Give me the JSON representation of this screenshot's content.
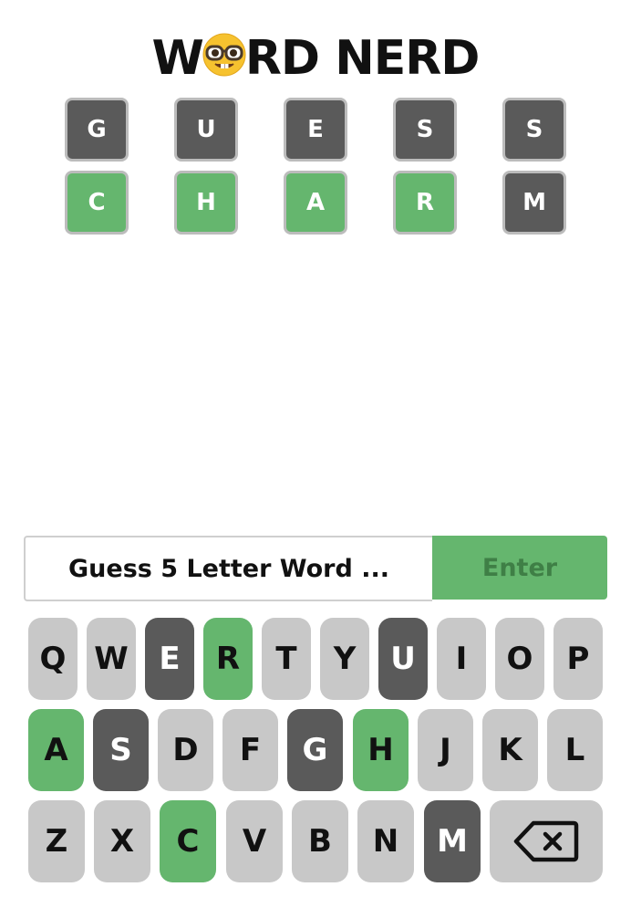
{
  "title": {
    "part1": "W",
    "part2": "RD NERD",
    "emoji": "nerd-face-icon"
  },
  "board": {
    "rows": [
      {
        "tiles": [
          {
            "letter": "G",
            "state": "dark"
          },
          {
            "letter": "U",
            "state": "dark"
          },
          {
            "letter": "E",
            "state": "dark"
          },
          {
            "letter": "S",
            "state": "dark"
          },
          {
            "letter": "S",
            "state": "dark"
          }
        ]
      },
      {
        "tiles": [
          {
            "letter": "C",
            "state": "green"
          },
          {
            "letter": "H",
            "state": "green"
          },
          {
            "letter": "A",
            "state": "green"
          },
          {
            "letter": "R",
            "state": "green"
          },
          {
            "letter": "M",
            "state": "dark"
          }
        ]
      }
    ]
  },
  "input": {
    "placeholder": "Guess 5 Letter Word ...",
    "enter_label": "Enter"
  },
  "keyboard": {
    "row1": [
      {
        "k": "Q",
        "s": "light"
      },
      {
        "k": "W",
        "s": "light"
      },
      {
        "k": "E",
        "s": "dark"
      },
      {
        "k": "R",
        "s": "green"
      },
      {
        "k": "T",
        "s": "light"
      },
      {
        "k": "Y",
        "s": "light"
      },
      {
        "k": "U",
        "s": "dark"
      },
      {
        "k": "I",
        "s": "light"
      },
      {
        "k": "O",
        "s": "light"
      },
      {
        "k": "P",
        "s": "light"
      }
    ],
    "row2": [
      {
        "k": "A",
        "s": "green"
      },
      {
        "k": "S",
        "s": "dark"
      },
      {
        "k": "D",
        "s": "light"
      },
      {
        "k": "F",
        "s": "light"
      },
      {
        "k": "G",
        "s": "dark"
      },
      {
        "k": "H",
        "s": "green"
      },
      {
        "k": "J",
        "s": "light"
      },
      {
        "k": "K",
        "s": "light"
      },
      {
        "k": "L",
        "s": "light"
      }
    ],
    "row3": [
      {
        "k": "Z",
        "s": "light"
      },
      {
        "k": "X",
        "s": "light"
      },
      {
        "k": "C",
        "s": "green"
      },
      {
        "k": "V",
        "s": "light"
      },
      {
        "k": "B",
        "s": "light"
      },
      {
        "k": "N",
        "s": "light"
      },
      {
        "k": "M",
        "s": "dark"
      }
    ],
    "backspace_icon": "backspace-icon"
  },
  "colors": {
    "green": "#65b66e",
    "dark": "#5a5a5a",
    "light": "#c8c8c8"
  }
}
